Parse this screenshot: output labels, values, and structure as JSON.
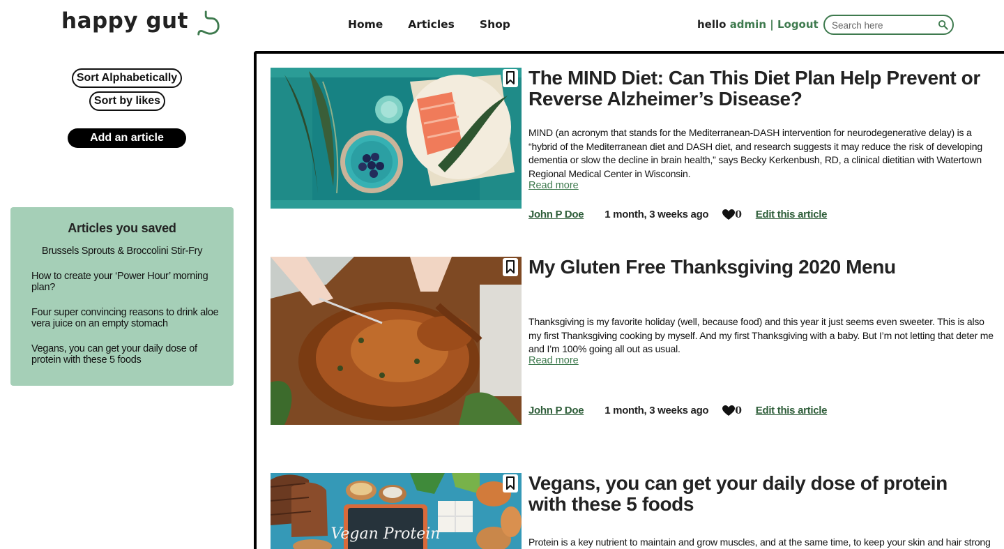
{
  "header": {
    "logo": "happy gut",
    "nav": [
      "Home",
      "Articles",
      "Shop"
    ],
    "user_greeting": "hello",
    "username": "admin",
    "separator": "|",
    "logout": "Logout",
    "search_placeholder": "Search here"
  },
  "sidebar": {
    "sort_alpha": "Sort Alphabetically",
    "sort_likes": "Sort by likes",
    "add_article": "Add an article",
    "saved_title": "Articles you saved",
    "saved_items": [
      "Brussels Sprouts & Broccolini Stir-Fry",
      "How to create your ‘Power Hour’ morning plan?",
      "Four super convincing reasons to drink aloe vera juice on an empty stomach",
      "Vegans, you can get your daily dose of protein with these 5 foods"
    ]
  },
  "articles": [
    {
      "title": "The MIND Diet: Can This Diet Plan Help Prevent or Reverse Alzheimer’s Disease?",
      "desc": "MIND (an acronym that stands for the Mediterranean-DASH intervention for neurodegenerative delay) is a “hybrid of the Mediterranean diet and DASH diet, and research suggests it may reduce the risk of developing dementia or slow the decline in brain health,” says Becky Kerkenbush, RD, a clinical dietitian with Watertown Regional Medical Center in Wisconsin.",
      "read_more": "Read more",
      "author": "John P Doe",
      "date": "1  month, 3  weeks ago",
      "likes": "0",
      "edit": "Edit this article"
    },
    {
      "title": "My Gluten Free Thanksgiving 2020 Menu",
      "desc": "Thanksgiving is my favorite holiday (well, because food) and this year it just seems even sweeter. This is also my first Thanksgiving cooking by myself. And my first Thanksgiving with a baby. But I’m not letting that deter me and I’m 100% going all out as usual.",
      "read_more": "Read more",
      "author": "John P Doe",
      "date": "1  month, 3  weeks ago",
      "likes": "0",
      "edit": "Edit this article"
    },
    {
      "title": "Vegans, you can get your daily dose of protein with these 5 foods",
      "desc": "Protein is a key nutrient to maintain and grow muscles, and at the same time, to keep your skin and hair strong",
      "image_text": "Vegan Protein"
    }
  ]
}
